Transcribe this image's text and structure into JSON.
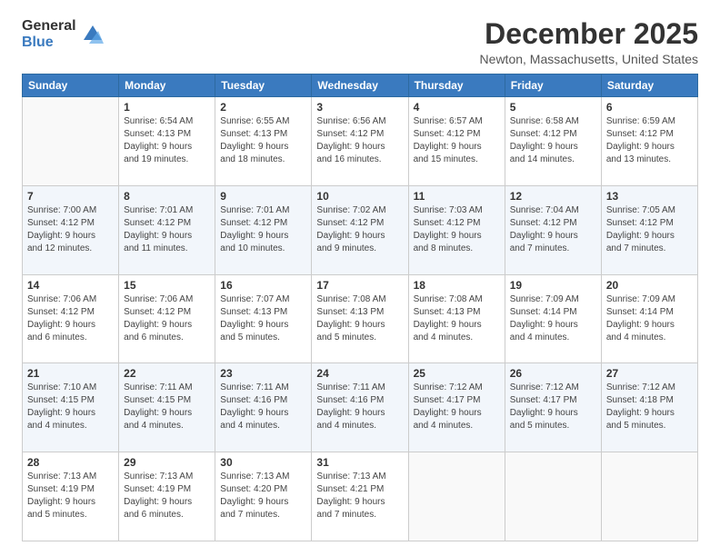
{
  "logo": {
    "general": "General",
    "blue": "Blue"
  },
  "header": {
    "month": "December 2025",
    "location": "Newton, Massachusetts, United States"
  },
  "weekdays": [
    "Sunday",
    "Monday",
    "Tuesday",
    "Wednesday",
    "Thursday",
    "Friday",
    "Saturday"
  ],
  "weeks": [
    [
      {
        "day": "",
        "info": ""
      },
      {
        "day": "1",
        "info": "Sunrise: 6:54 AM\nSunset: 4:13 PM\nDaylight: 9 hours\nand 19 minutes."
      },
      {
        "day": "2",
        "info": "Sunrise: 6:55 AM\nSunset: 4:13 PM\nDaylight: 9 hours\nand 18 minutes."
      },
      {
        "day": "3",
        "info": "Sunrise: 6:56 AM\nSunset: 4:12 PM\nDaylight: 9 hours\nand 16 minutes."
      },
      {
        "day": "4",
        "info": "Sunrise: 6:57 AM\nSunset: 4:12 PM\nDaylight: 9 hours\nand 15 minutes."
      },
      {
        "day": "5",
        "info": "Sunrise: 6:58 AM\nSunset: 4:12 PM\nDaylight: 9 hours\nand 14 minutes."
      },
      {
        "day": "6",
        "info": "Sunrise: 6:59 AM\nSunset: 4:12 PM\nDaylight: 9 hours\nand 13 minutes."
      }
    ],
    [
      {
        "day": "7",
        "info": "Sunrise: 7:00 AM\nSunset: 4:12 PM\nDaylight: 9 hours\nand 12 minutes."
      },
      {
        "day": "8",
        "info": "Sunrise: 7:01 AM\nSunset: 4:12 PM\nDaylight: 9 hours\nand 11 minutes."
      },
      {
        "day": "9",
        "info": "Sunrise: 7:01 AM\nSunset: 4:12 PM\nDaylight: 9 hours\nand 10 minutes."
      },
      {
        "day": "10",
        "info": "Sunrise: 7:02 AM\nSunset: 4:12 PM\nDaylight: 9 hours\nand 9 minutes."
      },
      {
        "day": "11",
        "info": "Sunrise: 7:03 AM\nSunset: 4:12 PM\nDaylight: 9 hours\nand 8 minutes."
      },
      {
        "day": "12",
        "info": "Sunrise: 7:04 AM\nSunset: 4:12 PM\nDaylight: 9 hours\nand 7 minutes."
      },
      {
        "day": "13",
        "info": "Sunrise: 7:05 AM\nSunset: 4:12 PM\nDaylight: 9 hours\nand 7 minutes."
      }
    ],
    [
      {
        "day": "14",
        "info": "Sunrise: 7:06 AM\nSunset: 4:12 PM\nDaylight: 9 hours\nand 6 minutes."
      },
      {
        "day": "15",
        "info": "Sunrise: 7:06 AM\nSunset: 4:12 PM\nDaylight: 9 hours\nand 6 minutes."
      },
      {
        "day": "16",
        "info": "Sunrise: 7:07 AM\nSunset: 4:13 PM\nDaylight: 9 hours\nand 5 minutes."
      },
      {
        "day": "17",
        "info": "Sunrise: 7:08 AM\nSunset: 4:13 PM\nDaylight: 9 hours\nand 5 minutes."
      },
      {
        "day": "18",
        "info": "Sunrise: 7:08 AM\nSunset: 4:13 PM\nDaylight: 9 hours\nand 4 minutes."
      },
      {
        "day": "19",
        "info": "Sunrise: 7:09 AM\nSunset: 4:14 PM\nDaylight: 9 hours\nand 4 minutes."
      },
      {
        "day": "20",
        "info": "Sunrise: 7:09 AM\nSunset: 4:14 PM\nDaylight: 9 hours\nand 4 minutes."
      }
    ],
    [
      {
        "day": "21",
        "info": "Sunrise: 7:10 AM\nSunset: 4:15 PM\nDaylight: 9 hours\nand 4 minutes."
      },
      {
        "day": "22",
        "info": "Sunrise: 7:11 AM\nSunset: 4:15 PM\nDaylight: 9 hours\nand 4 minutes."
      },
      {
        "day": "23",
        "info": "Sunrise: 7:11 AM\nSunset: 4:16 PM\nDaylight: 9 hours\nand 4 minutes."
      },
      {
        "day": "24",
        "info": "Sunrise: 7:11 AM\nSunset: 4:16 PM\nDaylight: 9 hours\nand 4 minutes."
      },
      {
        "day": "25",
        "info": "Sunrise: 7:12 AM\nSunset: 4:17 PM\nDaylight: 9 hours\nand 4 minutes."
      },
      {
        "day": "26",
        "info": "Sunrise: 7:12 AM\nSunset: 4:17 PM\nDaylight: 9 hours\nand 5 minutes."
      },
      {
        "day": "27",
        "info": "Sunrise: 7:12 AM\nSunset: 4:18 PM\nDaylight: 9 hours\nand 5 minutes."
      }
    ],
    [
      {
        "day": "28",
        "info": "Sunrise: 7:13 AM\nSunset: 4:19 PM\nDaylight: 9 hours\nand 5 minutes."
      },
      {
        "day": "29",
        "info": "Sunrise: 7:13 AM\nSunset: 4:19 PM\nDaylight: 9 hours\nand 6 minutes."
      },
      {
        "day": "30",
        "info": "Sunrise: 7:13 AM\nSunset: 4:20 PM\nDaylight: 9 hours\nand 7 minutes."
      },
      {
        "day": "31",
        "info": "Sunrise: 7:13 AM\nSunset: 4:21 PM\nDaylight: 9 hours\nand 7 minutes."
      },
      {
        "day": "",
        "info": ""
      },
      {
        "day": "",
        "info": ""
      },
      {
        "day": "",
        "info": ""
      }
    ]
  ]
}
